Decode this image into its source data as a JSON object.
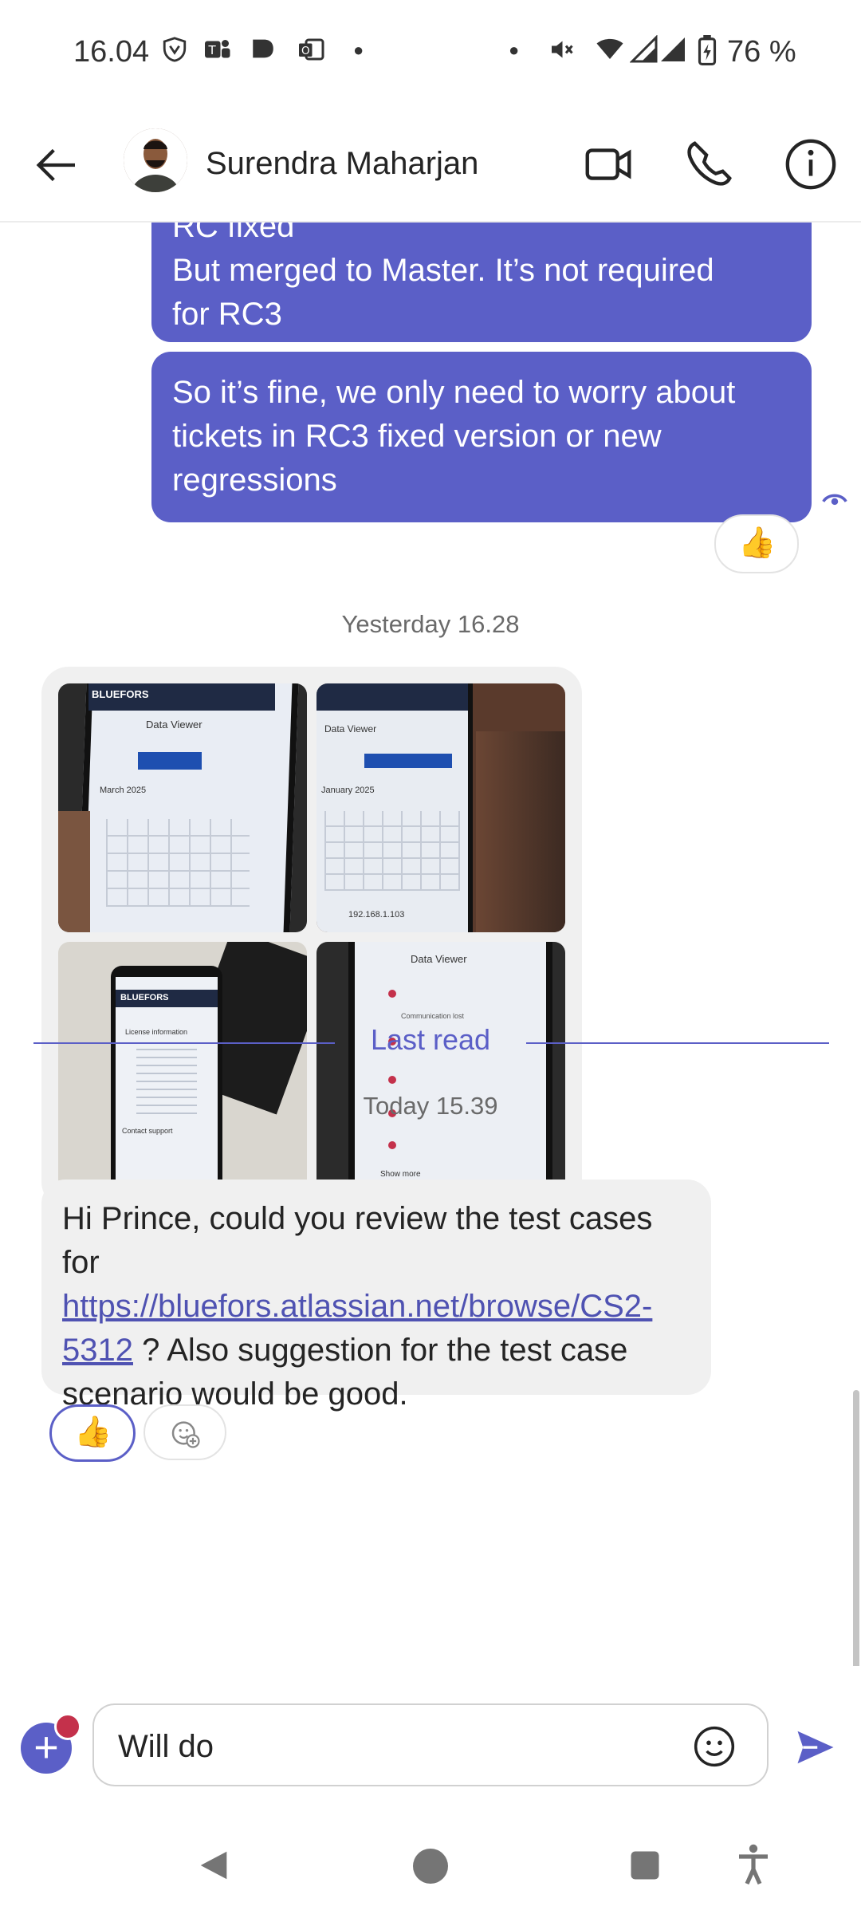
{
  "status_bar": {
    "time": "16.04",
    "battery": "76 %"
  },
  "header": {
    "contact_name": "Surendra Maharjan"
  },
  "messages": {
    "outgoing_1": {
      "partial_top": "RC fixed",
      "line1": "But merged to Master. It’s not required",
      "line2": "for RC3"
    },
    "outgoing_2": {
      "line1": "So it’s fine, we only need to worry about",
      "line2": "tickets in RC3 fixed version or new",
      "line3": "regressions"
    },
    "reaction_outgoing": "👍",
    "timestamp_yesterday": "Yesterday 16.28",
    "images": [
      {
        "caption": "BLUEFORS",
        "screen": "Data Viewer",
        "sub": "March 2025"
      },
      {
        "caption": "Data Viewer",
        "screen": "January 2025",
        "sub": "192.168.1.103"
      },
      {
        "caption": "BLUEFORS",
        "screen": "License information",
        "sub": "Contact support"
      },
      {
        "caption": "Data Viewer",
        "screen": "Communication lost",
        "sub": "Show more"
      }
    ],
    "last_read_label": "Last read",
    "timestamp_today": "Today 15.39",
    "incoming": {
      "part1": "Hi Prince, could you review the test cases for ",
      "link": "https://bluefors.atlassian.net/browse/CS2-5312",
      "part2": " ? Also suggestion for the test case scenario would be good."
    },
    "reaction_incoming": "👍"
  },
  "composer": {
    "value": "Will do"
  },
  "colors": {
    "accent": "#5b5fc7",
    "bubble_in": "#f0f0f0",
    "badge": "#c4314b"
  }
}
